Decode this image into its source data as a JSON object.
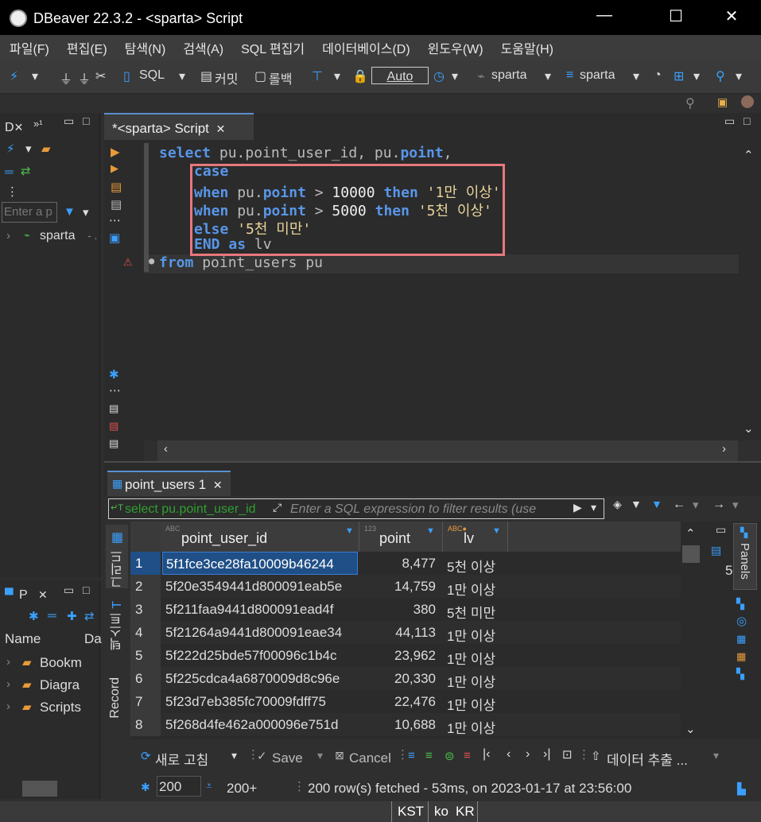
{
  "window": {
    "title": "DBeaver 22.3.2 - <sparta> Script"
  },
  "menu": [
    "파일(F)",
    "편집(E)",
    "탐색(N)",
    "검색(A)",
    "SQL 편집기",
    "데이터베이스(D)",
    "윈도우(W)",
    "도움말(H)"
  ],
  "toolbar": {
    "sql": "SQL",
    "commit": "커밋",
    "rollback": "롤백",
    "auto": "Auto",
    "datasource": "sparta",
    "schema": "sparta"
  },
  "left_panel": {
    "tab": "D",
    "filter_placeholder": "Enter a p",
    "tree_item": "sparta",
    "tree_suffix": "- ."
  },
  "projects_panel": {
    "tab": "P",
    "col_name": "Name",
    "col_da": "Da",
    "items": [
      "Bookm",
      "Diagra",
      "Scripts"
    ]
  },
  "editor": {
    "tab": "*<sparta> Script",
    "lines": {
      "l1": {
        "select": "select",
        "rest": " pu.point_user_id, pu.",
        "point": "point",
        "comma": ","
      },
      "l2": {
        "case": "case"
      },
      "l3": {
        "when": "when",
        "pu": " pu.",
        "point": "point",
        "gt": " > ",
        "num": "10000",
        "then": "then",
        "str": "'1만 이상'"
      },
      "l4": {
        "when": "when",
        "pu": " pu.",
        "point": "point",
        "gt": " > ",
        "num": "5000",
        "then": "then",
        "str": "'5천 이상'"
      },
      "l5": {
        "else": "else",
        "str": "'5천 미만'"
      },
      "l6": {
        "end": "END",
        "as": "as",
        "alias": "lv"
      },
      "l7": {
        "from": "from",
        "rest": " point_users pu"
      }
    }
  },
  "results": {
    "tab": "point_users 1",
    "filter_sql": "select pu.point_user_id",
    "filter_placeholder": "Enter a SQL expression to filter results (use",
    "vertical_tabs": [
      "그리드",
      "텍스트",
      "Record"
    ],
    "columns": [
      "point_user_id",
      "point",
      "lv"
    ],
    "rows": [
      {
        "n": "1",
        "id": "5f1fce3ce28fa10009b46244",
        "point": "8,477",
        "lv": "5천 이상"
      },
      {
        "n": "2",
        "id": "5f20e3549441d800091eab5e",
        "point": "14,759",
        "lv": "1만 이상"
      },
      {
        "n": "3",
        "id": "5f211faa9441d800091ead4f",
        "point": "380",
        "lv": "5천 미만"
      },
      {
        "n": "4",
        "id": "5f21264a9441d800091eae34",
        "point": "44,113",
        "lv": "1만 이상"
      },
      {
        "n": "5",
        "id": "5f222d25bde57f00096c1b4c",
        "point": "23,962",
        "lv": "1만 이상"
      },
      {
        "n": "6",
        "id": "5f225cdca4a6870009d8c96e",
        "point": "20,330",
        "lv": "1만 이상"
      },
      {
        "n": "7",
        "id": "5f23d7eb385fc70009fdff75",
        "point": "22,476",
        "lv": "1만 이상"
      },
      {
        "n": "8",
        "id": "5f268d4fe462a000096e751d",
        "point": "10,688",
        "lv": "1만 이상"
      }
    ],
    "panels_label": "Panels",
    "side_value": "5",
    "actions": {
      "refresh": "새로 고침",
      "save": "Save",
      "cancel": "Cancel",
      "export": "데이터 추출 ..."
    },
    "fetch_size": "200",
    "fetch_more": "200+",
    "status": "200 row(s) fetched - 53ms, on 2023-01-17 at 23:56:00"
  },
  "statusbar": {
    "tz": "KST",
    "lang": "ko",
    "region": "KR"
  }
}
